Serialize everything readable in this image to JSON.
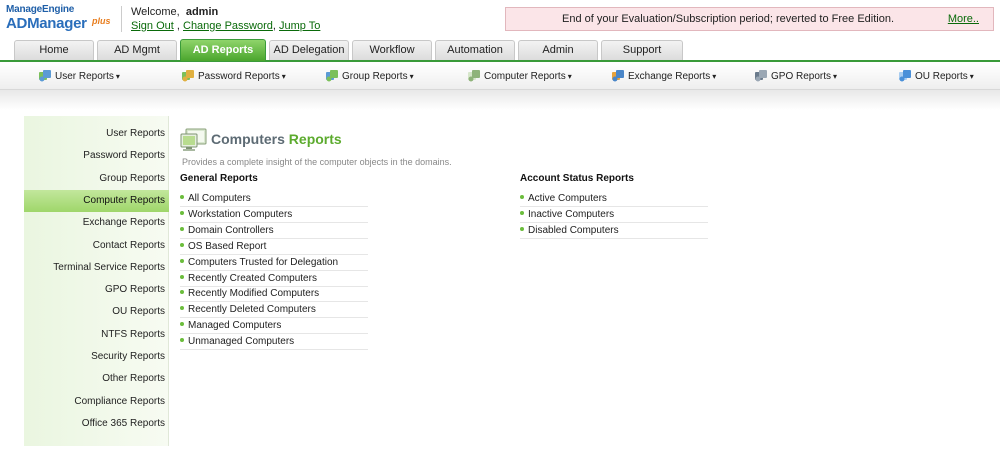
{
  "header": {
    "logo_top": "ManageEngine",
    "logo_main": "ADManager",
    "logo_plus": "plus",
    "welcome_label": "Welcome,",
    "user": "admin",
    "sign_out": "Sign Out",
    "link_sep": ",",
    "change_password": "Change Password",
    "jump_to": "Jump To",
    "notice_text": "End of your Evaluation/Subscription period; reverted to Free Edition.",
    "notice_more": "More.."
  },
  "tabs": [
    {
      "label": "Home"
    },
    {
      "label": "AD Mgmt"
    },
    {
      "label": "AD Reports",
      "active": true
    },
    {
      "label": "AD Delegation"
    },
    {
      "label": "Workflow"
    },
    {
      "label": "Automation"
    },
    {
      "label": "Admin"
    },
    {
      "label": "Support"
    }
  ],
  "submenu": [
    {
      "label": "User Reports",
      "icon": "users-icon"
    },
    {
      "label": "Password Reports",
      "icon": "password-icon"
    },
    {
      "label": "Group Reports",
      "icon": "group-icon"
    },
    {
      "label": "Computer Reports",
      "icon": "computer-icon"
    },
    {
      "label": "Exchange Reports",
      "icon": "exchange-icon"
    },
    {
      "label": "GPO Reports",
      "icon": "gpo-icon"
    },
    {
      "label": "OU Reports",
      "icon": "ou-icon"
    }
  ],
  "leftnav": [
    {
      "label": "User Reports"
    },
    {
      "label": "Password Reports"
    },
    {
      "label": "Group Reports"
    },
    {
      "label": "Computer Reports",
      "active": true
    },
    {
      "label": "Exchange Reports"
    },
    {
      "label": "Contact Reports"
    },
    {
      "label": "Terminal Service Reports"
    },
    {
      "label": "GPO Reports"
    },
    {
      "label": "OU Reports"
    },
    {
      "label": "NTFS Reports"
    },
    {
      "label": "Security Reports"
    },
    {
      "label": "Other Reports"
    },
    {
      "label": "Compliance Reports"
    },
    {
      "label": "Office 365 Reports"
    }
  ],
  "content": {
    "title_part1": "Computers",
    "title_part2": "Reports",
    "subtitle": "Provides a complete insight of the computer objects in the domains.",
    "general_heading": "General Reports",
    "general": [
      "All Computers",
      "Workstation Computers",
      "Domain Controllers",
      "OS Based Report",
      "Computers Trusted for Delegation",
      "Recently Created Computers",
      "Recently Modified Computers",
      "Recently Deleted Computers",
      "Managed Computers",
      "Unmanaged Computers"
    ],
    "account_heading": "Account Status Reports",
    "account": [
      "Active Computers",
      "Inactive Computers",
      "Disabled Computers"
    ]
  },
  "colors": {
    "accent_green": "#5cab2e",
    "tab_active": "#4aa52d",
    "notice_bg": "#fbe5e8",
    "link_green": "#0a6a0a"
  }
}
